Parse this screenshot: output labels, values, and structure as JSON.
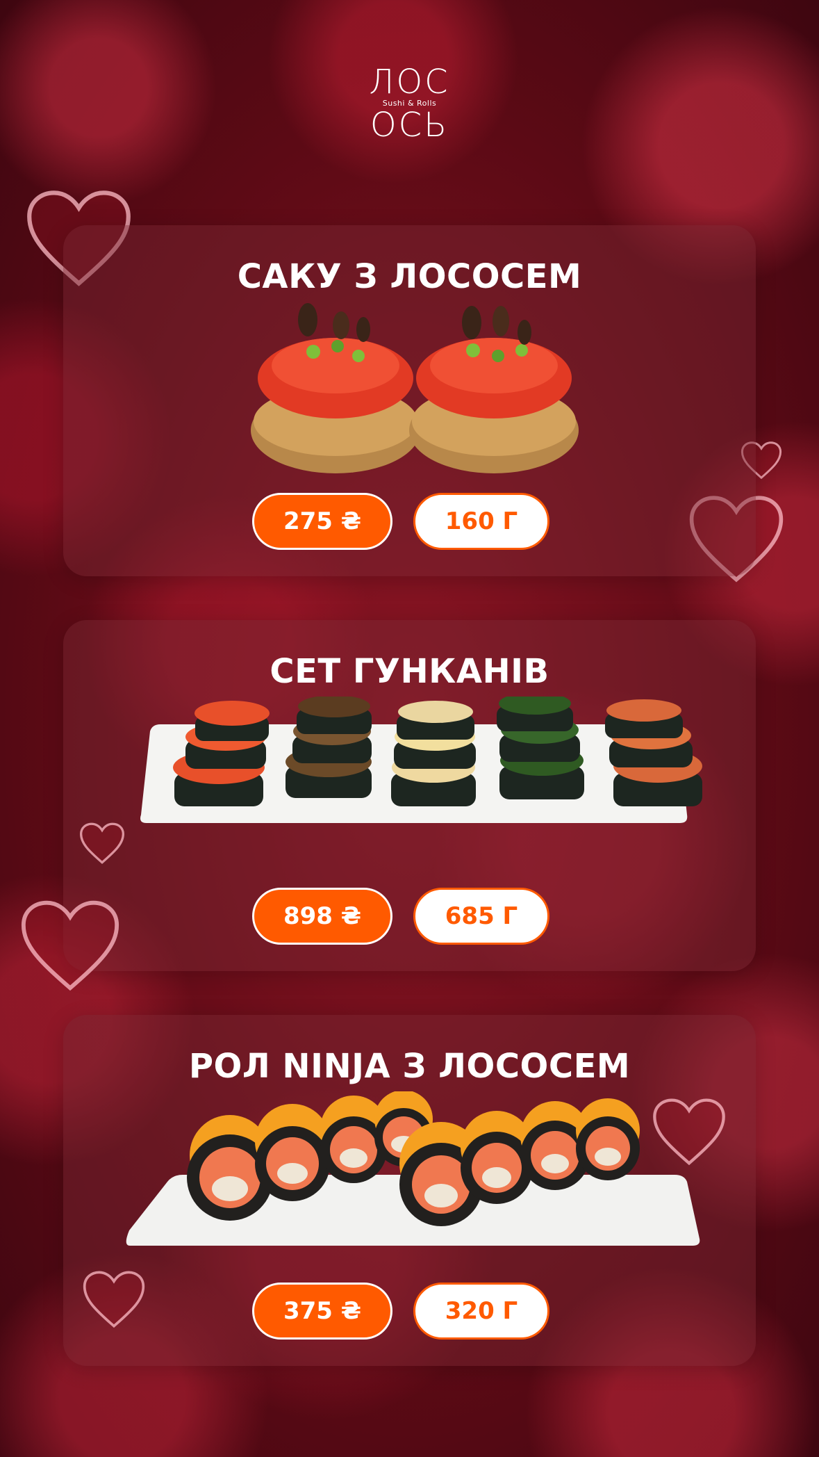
{
  "brand": {
    "line1": "ЛОС",
    "tagline": "Sushi & Rolls",
    "line2": "ОСЬ"
  },
  "items": [
    {
      "title": "САКУ З ЛОСОСЕМ",
      "price": "275 ₴",
      "weight": "160 Г"
    },
    {
      "title": "СЕТ ГУНКАНІВ",
      "price": "898 ₴",
      "weight": "685 Г"
    },
    {
      "title": "РОЛ NINJA З ЛОСОСЕМ",
      "price": "375 ₴",
      "weight": "320 Г"
    }
  ],
  "colors": {
    "accent": "#ff5a00",
    "background": "#7a1020"
  }
}
